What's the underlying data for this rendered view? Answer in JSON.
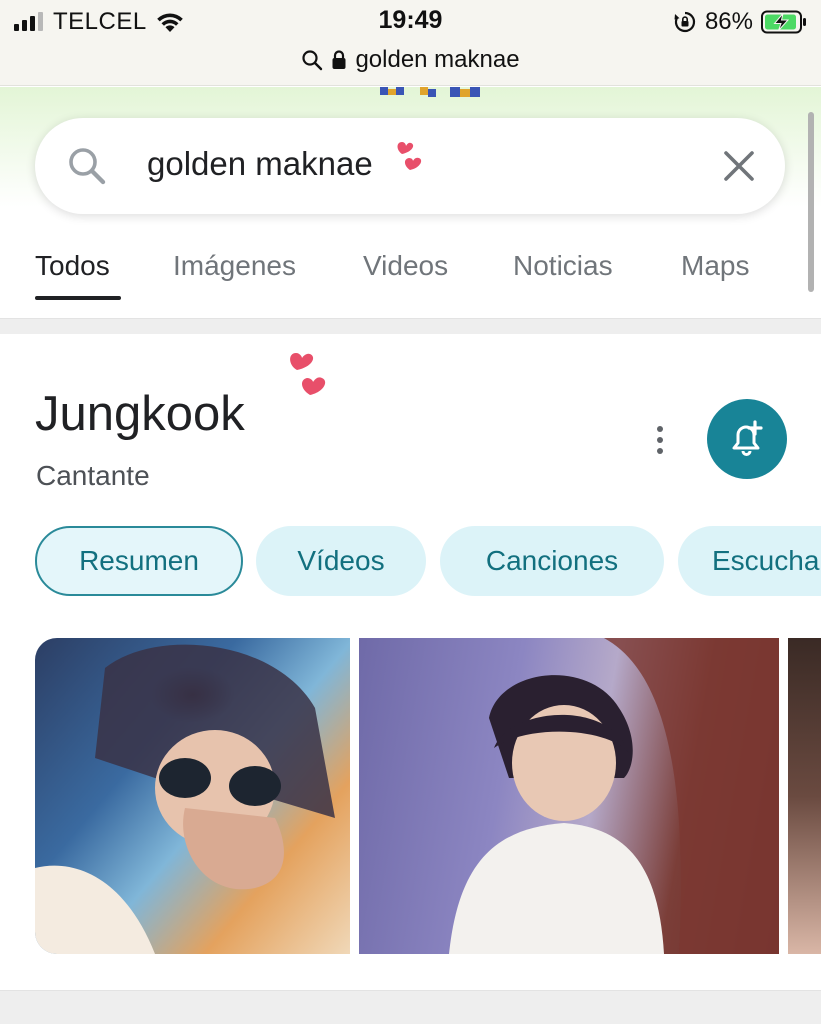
{
  "status_bar": {
    "carrier": "TELCEL",
    "time": "19:49",
    "battery_percent": "86%",
    "signal_bars_active": 3,
    "signal_bars_total": 4,
    "url": "golden maknae"
  },
  "search": {
    "query": "golden maknae"
  },
  "tabs": [
    {
      "label": "Todos",
      "active": true
    },
    {
      "label": "Imágenes",
      "active": false
    },
    {
      "label": "Videos",
      "active": false
    },
    {
      "label": "Noticias",
      "active": false
    },
    {
      "label": "Maps",
      "active": false
    }
  ],
  "knowledge_panel": {
    "title": "Jungkook",
    "subtitle": "Cantante",
    "chips": [
      {
        "label": "Resumen",
        "active": true
      },
      {
        "label": "Vídeos",
        "active": false
      },
      {
        "label": "Canciones",
        "active": false
      },
      {
        "label": "Escucha",
        "active": false
      }
    ]
  },
  "colors": {
    "accent_teal": "#188497",
    "chip_bg": "#dcf3f8",
    "chip_text": "#12707f",
    "heart_pink": "#e84f6a"
  },
  "icons": [
    "search-icon",
    "lock-icon",
    "wifi-icon",
    "rotation-lock-icon",
    "battery-charging-icon",
    "close-icon",
    "more-vert-icon",
    "bell-plus-icon",
    "heart-sticker"
  ]
}
